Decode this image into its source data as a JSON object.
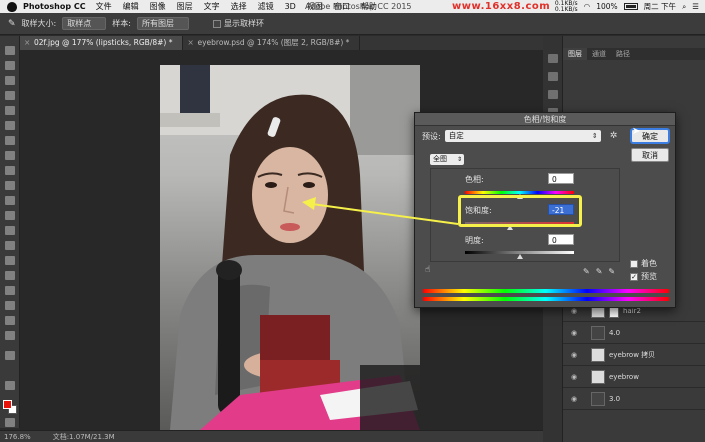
{
  "menubar": {
    "app": "Photoshop CC",
    "items": [
      "文件",
      "编辑",
      "图像",
      "图层",
      "文字",
      "选择",
      "滤镜",
      "3D",
      "视图",
      "窗口",
      "帮助"
    ],
    "window_title": "Adobe Photoshop CC 2015",
    "watermark": "www.16xx8.com",
    "net_up": "0.1KB/s",
    "net_down": "0.1KB/s",
    "battery": "100%",
    "clock": "周二 下午"
  },
  "options": {
    "sample_size_label": "取样大小:",
    "sample_size_value": "取样点",
    "sample_label": "样本:",
    "sample_value": "所有图层",
    "show_ring_label": "显示取样环"
  },
  "tabs": [
    {
      "label": "02f.jpg @ 177% (lipsticks, RGB/8#) *"
    },
    {
      "label": "eyebrow.psd @ 174% (图层 2, RGB/8#) *"
    }
  ],
  "status": {
    "zoom": "176.8%",
    "doc": "文档:1.07M/21.3M"
  },
  "panels": {
    "tabs": [
      "图层",
      "通道",
      "路径"
    ],
    "layers": [
      {
        "name": "hair2",
        "dark": false,
        "mask": true
      },
      {
        "name": "4.0",
        "dark": true,
        "mask": false
      },
      {
        "name": "eyebrow 拷贝",
        "dark": false,
        "mask": false
      },
      {
        "name": "eyebrow",
        "dark": false,
        "mask": false
      },
      {
        "name": "3.0",
        "dark": true,
        "mask": false
      }
    ]
  },
  "dialog": {
    "title": "色相/饱和度",
    "preset_label": "预设:",
    "preset_value": "自定",
    "ok": "确定",
    "cancel": "取消",
    "range": "全图",
    "hue_label": "色相:",
    "hue_value": "0",
    "sat_label": "饱和度:",
    "sat_value": "-21",
    "light_label": "明度:",
    "light_value": "0",
    "colorize_label": "着色",
    "preview_label": "预览",
    "colorize": false,
    "preview": true
  }
}
